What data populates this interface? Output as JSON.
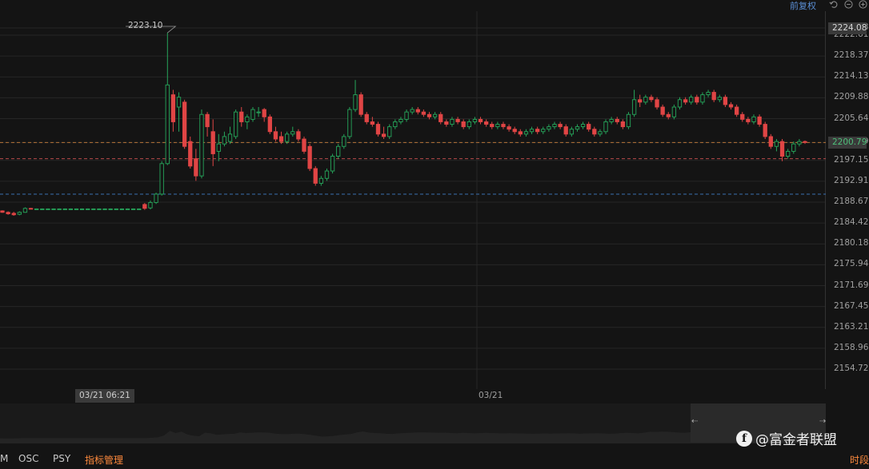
{
  "toolbar": {
    "adjust_label": "前复权",
    "icons": [
      "undo-icon",
      "minus-circle-icon",
      "plus-circle-icon"
    ]
  },
  "colors": {
    "up": "#26a65b",
    "down": "#e04545",
    "background": "#141414",
    "grid": "#262626",
    "accent": "#ff8a3d",
    "blue_line": "#3a6fb0"
  },
  "chart_data": {
    "type": "candlestick",
    "y_ticks": [
      "2224.08",
      "2222.61",
      "2218.37",
      "2214.13",
      "2209.88",
      "2205.64",
      "2200.79",
      "2197.15",
      "2192.91",
      "2188.67",
      "2184.42",
      "2180.18",
      "2175.94",
      "2171.69",
      "2167.45",
      "2163.21",
      "2158.96",
      "2154.72"
    ],
    "ylim": [
      2153.0,
      2226.0
    ],
    "high_annotation": "2223.10",
    "current_high_label": "2224.08",
    "last_price_label": "2200.79",
    "ref_lines": [
      2200.79,
      2197.5,
      2190.3
    ],
    "x_labels": [
      "03/21 06:21",
      "03/21"
    ],
    "candles": [
      [
        2186.9,
        2186.6,
        2187.0,
        2186.5
      ],
      [
        2186.6,
        2186.3,
        2186.8,
        2186.1
      ],
      [
        2186.4,
        2186.1,
        2186.7,
        2185.9
      ],
      [
        2186.2,
        2186.6,
        2186.8,
        2186.0
      ],
      [
        2186.6,
        2187.4,
        2187.6,
        2186.5
      ],
      [
        2187.4,
        2187.3,
        2187.5,
        2187.2
      ],
      [
        2187.3,
        2187.3,
        2187.4,
        2187.2
      ],
      [
        2187.3,
        2187.3,
        2187.4,
        2187.2
      ],
      [
        2187.3,
        2187.3,
        2187.4,
        2187.2
      ],
      [
        2187.3,
        2187.3,
        2187.4,
        2187.2
      ],
      [
        2187.3,
        2187.3,
        2187.4,
        2187.2
      ],
      [
        2187.3,
        2187.3,
        2187.4,
        2187.2
      ],
      [
        2187.3,
        2187.3,
        2187.4,
        2187.2
      ],
      [
        2187.3,
        2187.3,
        2187.4,
        2187.2
      ],
      [
        2187.3,
        2187.3,
        2187.4,
        2187.2
      ],
      [
        2187.3,
        2187.3,
        2187.4,
        2187.2
      ],
      [
        2187.3,
        2187.3,
        2187.4,
        2187.2
      ],
      [
        2187.3,
        2187.3,
        2187.4,
        2187.2
      ],
      [
        2187.3,
        2187.3,
        2187.4,
        2187.2
      ],
      [
        2187.3,
        2187.3,
        2187.4,
        2187.2
      ],
      [
        2187.3,
        2187.3,
        2187.4,
        2187.2
      ],
      [
        2187.3,
        2187.3,
        2187.4,
        2187.2
      ],
      [
        2187.3,
        2187.3,
        2187.4,
        2187.2
      ],
      [
        2187.3,
        2187.3,
        2187.4,
        2187.2
      ],
      [
        2187.3,
        2187.3,
        2187.4,
        2187.2
      ],
      [
        2188.2,
        2187.4,
        2188.5,
        2187.1
      ],
      [
        2187.5,
        2188.6,
        2189.0,
        2187.2
      ],
      [
        2188.6,
        2190.3,
        2190.6,
        2188.3
      ],
      [
        2190.3,
        2196.5,
        2197.0,
        2190.0
      ],
      [
        2196.5,
        2212.5,
        2223.1,
        2196.2
      ],
      [
        2210.5,
        2205.0,
        2211.5,
        2203.0
      ],
      [
        2208.0,
        2210.0,
        2211.0,
        2203.0
      ],
      [
        2209.0,
        2200.0,
        2209.5,
        2199.5
      ],
      [
        2201.0,
        2196.0,
        2202.0,
        2195.5
      ],
      [
        2197.5,
        2194.0,
        2199.5,
        2193.0
      ],
      [
        2194.0,
        2206.5,
        2207.5,
        2193.5
      ],
      [
        2206.5,
        2204.0,
        2207.0,
        2202.0
      ],
      [
        2203.0,
        2198.5,
        2205.5,
        2196.0
      ],
      [
        2199.0,
        2200.5,
        2202.5,
        2197.0
      ],
      [
        2200.5,
        2202.0,
        2203.0,
        2200.0
      ],
      [
        2201.0,
        2202.5,
        2204.0,
        2200.5
      ],
      [
        2202.0,
        2207.0,
        2207.5,
        2201.5
      ],
      [
        2207.0,
        2205.0,
        2208.0,
        2204.0
      ],
      [
        2205.0,
        2206.0,
        2206.5,
        2203.5
      ],
      [
        2205.5,
        2207.5,
        2208.0,
        2205.0
      ],
      [
        2207.0,
        2207.0,
        2208.0,
        2206.0
      ],
      [
        2207.5,
        2206.0,
        2207.8,
        2205.0
      ],
      [
        2206.0,
        2203.0,
        2206.5,
        2202.5
      ],
      [
        2203.0,
        2201.5,
        2204.0,
        2201.0
      ],
      [
        2202.0,
        2201.0,
        2203.0,
        2200.5
      ],
      [
        2201.0,
        2202.5,
        2203.0,
        2200.5
      ],
      [
        2202.5,
        2203.0,
        2204.0,
        2202.0
      ],
      [
        2203.0,
        2201.5,
        2203.5,
        2201.0
      ],
      [
        2201.5,
        2199.0,
        2202.0,
        2198.5
      ],
      [
        2200.0,
        2195.5,
        2200.5,
        2195.0
      ],
      [
        2195.5,
        2192.5,
        2196.0,
        2192.0
      ],
      [
        2192.5,
        2193.5,
        2194.0,
        2192.0
      ],
      [
        2193.5,
        2195.0,
        2195.5,
        2193.0
      ],
      [
        2195.0,
        2198.0,
        2198.5,
        2194.5
      ],
      [
        2198.0,
        2200.0,
        2200.5,
        2197.5
      ],
      [
        2200.0,
        2202.0,
        2202.5,
        2199.5
      ],
      [
        2202.0,
        2207.5,
        2208.0,
        2201.5
      ],
      [
        2207.5,
        2210.5,
        2213.5,
        2207.0
      ],
      [
        2210.5,
        2206.5,
        2211.0,
        2206.0
      ],
      [
        2206.5,
        2205.0,
        2207.0,
        2204.5
      ],
      [
        2205.0,
        2204.5,
        2206.0,
        2204.0
      ],
      [
        2204.5,
        2202.5,
        2205.0,
        2202.0
      ],
      [
        2202.5,
        2202.0,
        2204.0,
        2201.5
      ],
      [
        2202.0,
        2204.0,
        2204.5,
        2201.5
      ],
      [
        2204.0,
        2205.0,
        2205.5,
        2203.5
      ],
      [
        2205.0,
        2205.5,
        2206.0,
        2204.5
      ],
      [
        2205.5,
        2207.0,
        2207.5,
        2205.0
      ],
      [
        2207.0,
        2207.5,
        2208.0,
        2206.5
      ],
      [
        2207.5,
        2207.0,
        2208.0,
        2206.5
      ],
      [
        2207.0,
        2206.5,
        2207.5,
        2206.0
      ],
      [
        2206.5,
        2206.0,
        2207.0,
        2205.5
      ],
      [
        2206.0,
        2206.5,
        2207.0,
        2205.5
      ],
      [
        2206.5,
        2205.0,
        2207.0,
        2204.5
      ],
      [
        2205.0,
        2204.5,
        2205.5,
        2204.0
      ],
      [
        2204.5,
        2205.5,
        2206.0,
        2204.0
      ],
      [
        2205.5,
        2205.0,
        2206.0,
        2204.5
      ],
      [
        2205.0,
        2204.0,
        2205.5,
        2203.5
      ],
      [
        2204.0,
        2205.0,
        2205.5,
        2203.5
      ],
      [
        2205.0,
        2205.5,
        2206.0,
        2204.5
      ],
      [
        2205.5,
        2205.0,
        2206.0,
        2204.5
      ],
      [
        2205.0,
        2204.5,
        2205.5,
        2204.0
      ],
      [
        2204.5,
        2204.0,
        2205.0,
        2203.5
      ],
      [
        2204.0,
        2204.5,
        2205.0,
        2203.5
      ],
      [
        2204.5,
        2204.0,
        2205.0,
        2203.5
      ],
      [
        2204.0,
        2203.5,
        2204.5,
        2203.0
      ],
      [
        2203.5,
        2203.0,
        2204.0,
        2202.5
      ],
      [
        2203.0,
        2202.5,
        2203.5,
        2202.0
      ],
      [
        2202.5,
        2203.0,
        2203.5,
        2202.0
      ],
      [
        2203.0,
        2203.5,
        2204.0,
        2202.5
      ],
      [
        2203.5,
        2203.0,
        2204.0,
        2202.5
      ],
      [
        2203.0,
        2203.5,
        2204.0,
        2202.5
      ],
      [
        2203.5,
        2204.0,
        2204.5,
        2203.0
      ],
      [
        2204.0,
        2204.5,
        2205.0,
        2203.5
      ],
      [
        2204.5,
        2204.0,
        2205.0,
        2203.5
      ],
      [
        2204.0,
        2202.5,
        2204.5,
        2202.0
      ],
      [
        2202.5,
        2203.5,
        2204.0,
        2202.0
      ],
      [
        2203.5,
        2204.0,
        2204.5,
        2203.0
      ],
      [
        2204.0,
        2204.5,
        2205.0,
        2203.5
      ],
      [
        2204.5,
        2203.5,
        2205.0,
        2203.0
      ],
      [
        2203.5,
        2202.5,
        2204.0,
        2202.0
      ],
      [
        2202.5,
        2203.0,
        2203.5,
        2202.0
      ],
      [
        2203.0,
        2205.0,
        2205.5,
        2202.5
      ],
      [
        2205.0,
        2205.5,
        2206.0,
        2204.5
      ],
      [
        2205.5,
        2205.0,
        2206.0,
        2204.5
      ],
      [
        2205.0,
        2204.0,
        2205.5,
        2203.5
      ],
      [
        2204.0,
        2206.5,
        2207.0,
        2203.5
      ],
      [
        2206.5,
        2209.5,
        2211.5,
        2206.0
      ],
      [
        2209.5,
        2209.0,
        2210.5,
        2208.0
      ],
      [
        2209.0,
        2210.0,
        2210.5,
        2208.5
      ],
      [
        2210.0,
        2209.5,
        2210.5,
        2209.0
      ],
      [
        2209.5,
        2208.0,
        2210.0,
        2207.5
      ],
      [
        2208.0,
        2206.5,
        2208.5,
        2206.0
      ],
      [
        2206.5,
        2206.0,
        2207.0,
        2205.5
      ],
      [
        2206.0,
        2208.0,
        2208.5,
        2205.5
      ],
      [
        2208.0,
        2209.5,
        2210.0,
        2207.5
      ],
      [
        2209.5,
        2209.0,
        2210.0,
        2208.5
      ],
      [
        2209.0,
        2210.0,
        2210.5,
        2208.5
      ],
      [
        2210.0,
        2209.0,
        2210.5,
        2208.5
      ],
      [
        2209.0,
        2210.5,
        2211.0,
        2208.5
      ],
      [
        2210.5,
        2211.0,
        2211.5,
        2210.0
      ],
      [
        2211.0,
        2209.5,
        2211.5,
        2209.0
      ],
      [
        2209.5,
        2210.0,
        2210.5,
        2209.0
      ],
      [
        2210.0,
        2208.5,
        2210.5,
        2208.0
      ],
      [
        2208.5,
        2208.0,
        2209.0,
        2207.5
      ],
      [
        2208.0,
        2206.5,
        2208.5,
        2206.0
      ],
      [
        2206.5,
        2205.5,
        2207.0,
        2205.0
      ],
      [
        2205.5,
        2205.0,
        2206.0,
        2204.5
      ],
      [
        2205.0,
        2206.0,
        2206.5,
        2204.5
      ],
      [
        2206.0,
        2204.5,
        2206.5,
        2204.0
      ],
      [
        2204.5,
        2202.0,
        2205.0,
        2201.5
      ],
      [
        2202.0,
        2200.0,
        2202.5,
        2199.5
      ],
      [
        2200.0,
        2201.0,
        2201.5,
        2199.0
      ],
      [
        2201.0,
        2198.0,
        2201.5,
        2197.0
      ],
      [
        2198.0,
        2199.0,
        2199.5,
        2197.5
      ],
      [
        2199.0,
        2200.5,
        2201.0,
        2198.5
      ],
      [
        2200.5,
        2201.0,
        2201.5,
        2200.0
      ],
      [
        2201.0,
        2200.8,
        2201.2,
        2200.5
      ]
    ]
  },
  "bottom_tabs": {
    "tab_m": "M",
    "tab_osc": "OSC",
    "tab_psy": "PSY",
    "tab_manage": "指标管理",
    "tab_time": "时段"
  },
  "watermark": {
    "text": "@富金者联盟"
  }
}
